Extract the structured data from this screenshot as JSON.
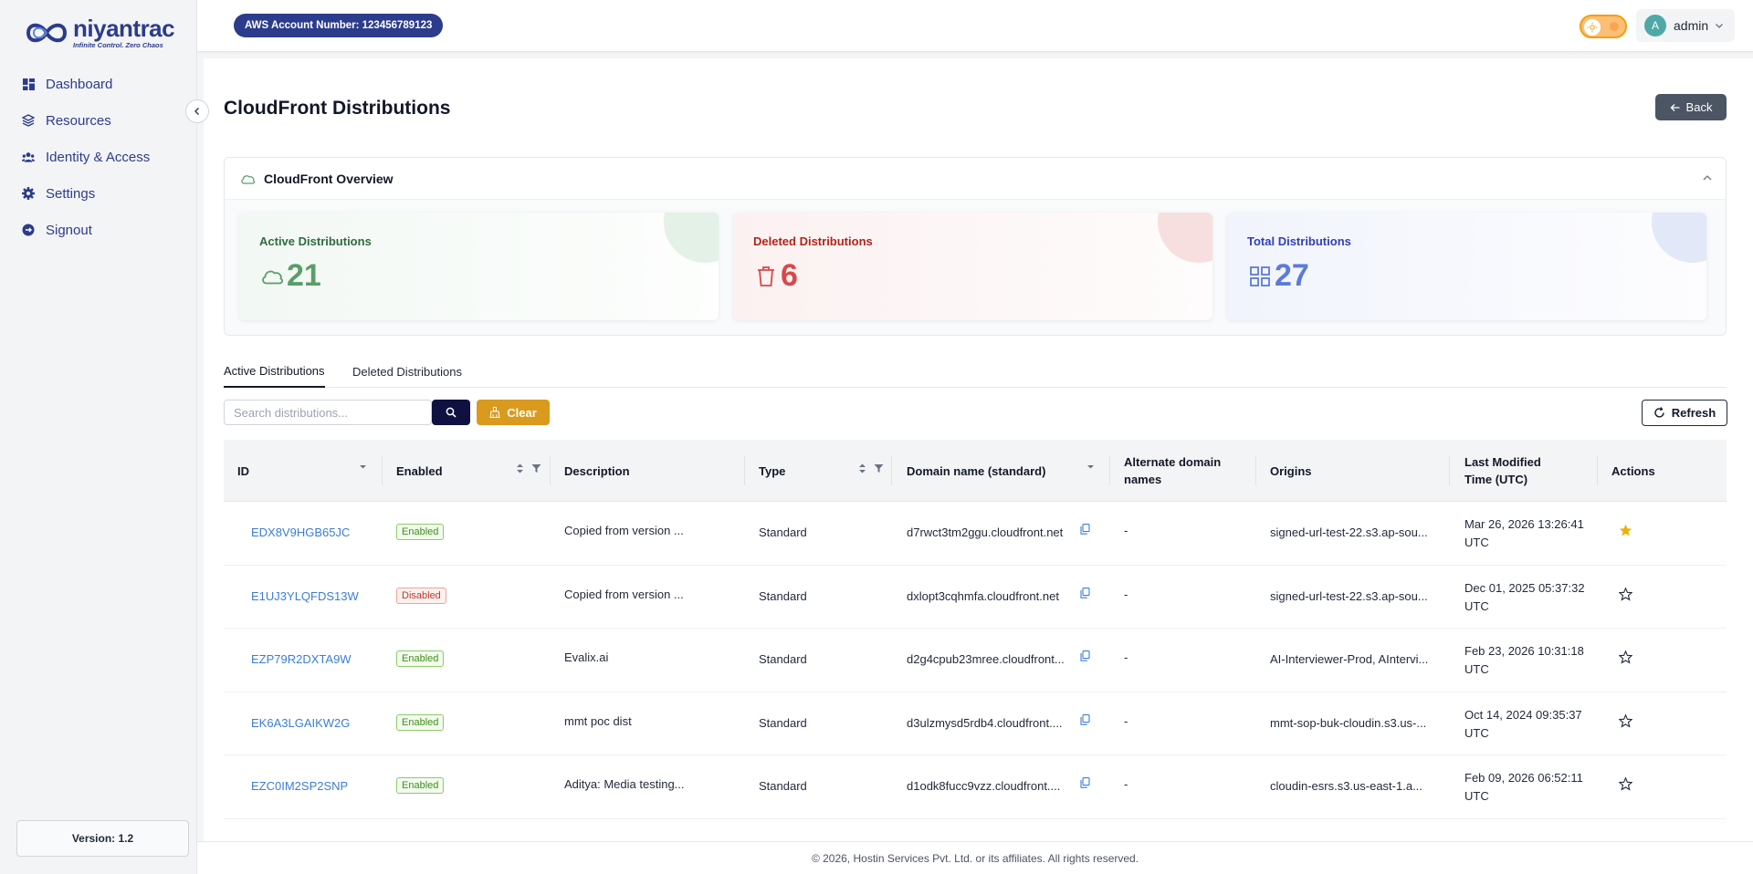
{
  "brand": {
    "name": "niyantrac",
    "tagline": "Infinite Control. Zero Chaos"
  },
  "sidebar": {
    "items": [
      {
        "label": "Dashboard",
        "icon": "dashboard-icon"
      },
      {
        "label": "Resources",
        "icon": "layers-icon"
      },
      {
        "label": "Identity & Access",
        "icon": "users-icon"
      },
      {
        "label": "Settings",
        "icon": "gear-icon"
      },
      {
        "label": "Signout",
        "icon": "signout-icon"
      }
    ],
    "version": "Version: 1.2"
  },
  "topbar": {
    "aws_account": "AWS Account Number: 123456789123",
    "avatar_initial": "A",
    "user": "admin"
  },
  "page": {
    "title": "CloudFront Distributions",
    "back_label": "Back"
  },
  "overview": {
    "title": "CloudFront Overview",
    "stats": [
      {
        "label": "Active Distributions",
        "value": "21",
        "icon": "cloud-icon",
        "color": "#5a9e68"
      },
      {
        "label": "Deleted Distributions",
        "value": "6",
        "icon": "trash-icon",
        "color": "#d94848"
      },
      {
        "label": "Total Distributions",
        "value": "27",
        "icon": "grid-icon",
        "color": "#5b7bd8"
      }
    ]
  },
  "tabs": [
    {
      "label": "Active Distributions"
    },
    {
      "label": "Deleted Distributions"
    }
  ],
  "toolbar": {
    "search_placeholder": "Search distributions...",
    "clear_label": "Clear",
    "refresh_label": "Refresh"
  },
  "table": {
    "columns": [
      "ID",
      "Enabled",
      "Description",
      "Type",
      "Domain name (standard)",
      "Alternate domain names",
      "Origins",
      "Last Modified Time (UTC)",
      "Actions"
    ],
    "rows": [
      {
        "id": "EDX8V9HGB65JC",
        "enabled": "Enabled",
        "description": "Copied from version ...",
        "type": "Standard",
        "domain": "d7rwct3tm2ggu.cloudfront.net",
        "alternate": "-",
        "origins": "signed-url-test-22.s3.ap-sou...",
        "modified_1": "Mar 26, 2026 13:26:41",
        "modified_2": "UTC",
        "starred": true
      },
      {
        "id": "E1UJ3YLQFDS13W",
        "enabled": "Disabled",
        "description": "Copied from version ...",
        "type": "Standard",
        "domain": "dxlopt3cqhmfa.cloudfront.net",
        "alternate": "-",
        "origins": "signed-url-test-22.s3.ap-sou...",
        "modified_1": "Dec 01, 2025 05:37:32",
        "modified_2": "UTC",
        "starred": false
      },
      {
        "id": "EZP79R2DXTA9W",
        "enabled": "Enabled",
        "description": "Evalix.ai",
        "type": "Standard",
        "domain": "d2g4cpub23mree.cloudfront...",
        "alternate": "-",
        "origins": "AI-Interviewer-Prod, AIntervi...",
        "modified_1": "Feb 23, 2026 10:31:18",
        "modified_2": "UTC",
        "starred": false
      },
      {
        "id": "EK6A3LGAIKW2G",
        "enabled": "Enabled",
        "description": "mmt poc dist",
        "type": "Standard",
        "domain": "d3ulzmysd5rdb4.cloudfront....",
        "alternate": "-",
        "origins": "mmt-sop-buk-cloudin.s3.us-...",
        "modified_1": "Oct 14, 2024 09:35:37",
        "modified_2": "UTC",
        "starred": false
      },
      {
        "id": "EZC0IM2SP2SNP",
        "enabled": "Enabled",
        "description": "Aditya: Media testing...",
        "type": "Standard",
        "domain": "d1odk8fucc9vzz.cloudfront....",
        "alternate": "-",
        "origins": "cloudin-esrs.s3.us-east-1.a...",
        "modified_1": "Feb 09, 2026 06:52:11",
        "modified_2": "UTC",
        "starred": false
      }
    ]
  },
  "footer": {
    "text": "© 2026, Hostin Services Pvt. Ltd. or its affiliates. All rights reserved."
  }
}
